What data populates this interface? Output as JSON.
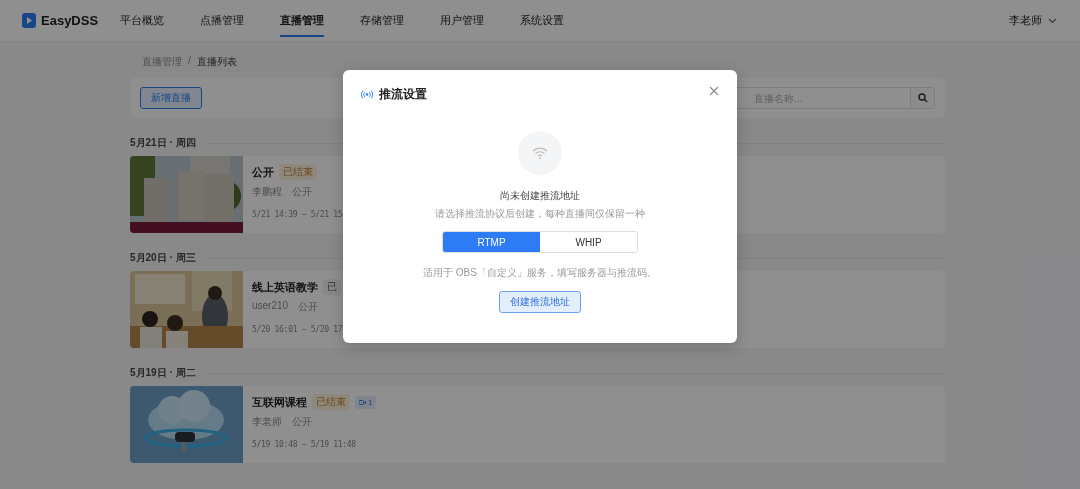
{
  "header": {
    "logo": "EasyDSS",
    "nav": [
      {
        "label": "平台概览",
        "selected": false
      },
      {
        "label": "点播管理",
        "selected": false
      },
      {
        "label": "直播管理",
        "selected": true
      },
      {
        "label": "存储管理",
        "selected": false
      },
      {
        "label": "用户管理",
        "selected": false
      },
      {
        "label": "系统设置",
        "selected": false
      }
    ],
    "user": "李老师"
  },
  "breadcrumb": {
    "items": [
      "直播管理",
      "直播列表"
    ],
    "separator": "/"
  },
  "toolbar": {
    "new_button": "新增直播",
    "search": {
      "placeholder": "直播名称..."
    }
  },
  "groups": [
    {
      "date": "5月21日 · 周四",
      "items": [
        {
          "title": "公开",
          "status": {
            "label": "已结束",
            "kind": "ended"
          },
          "owner": "李鹏程",
          "visibility": "公开",
          "time": "5/21 14:39 – 5/21 15"
        }
      ]
    },
    {
      "date": "5月20日 · 周三",
      "items": [
        {
          "title": "线上英语教学",
          "status": {
            "label": "已",
            "kind": "closed"
          },
          "owner": "user210",
          "visibility": "公开",
          "time": "5/20 16:01 – 5/20 17"
        }
      ]
    },
    {
      "date": "5月19日 · 周二",
      "items": [
        {
          "title": "互联网课程",
          "status": {
            "label": "已结束",
            "kind": "ended"
          },
          "viewers": "1",
          "owner": "李老师",
          "visibility": "公开",
          "time": "5/19 10:48 – 5/19 11:48"
        }
      ]
    }
  ],
  "modal": {
    "title": "推流设置",
    "empty_title": "尚未创建推流地址",
    "empty_hint": "请选择推流协议后创建，每种直播间仅保留一种",
    "protocols": [
      {
        "label": "RTMP",
        "selected": true
      },
      {
        "label": "WHIP",
        "selected": false
      }
    ],
    "note": "适用于 OBS「自定义」服务，填写服务器与推流码。",
    "create_button": "创建推流地址"
  }
}
